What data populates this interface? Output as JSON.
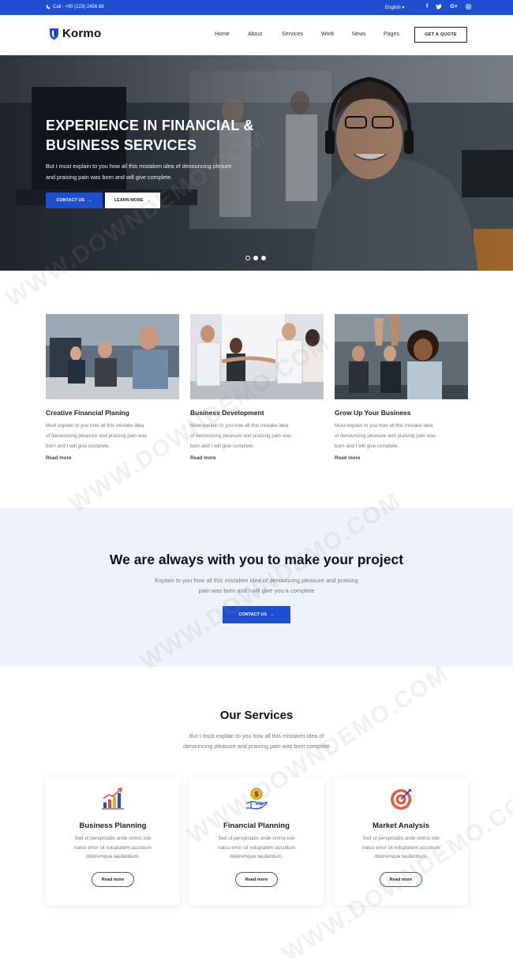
{
  "topbar": {
    "phone": "Call : +00 (123) 2456 88",
    "language": "English",
    "socials": [
      "f",
      "t",
      "G+",
      "ig"
    ]
  },
  "header": {
    "brand": "Kormo",
    "nav": [
      "Home",
      "About",
      "Services",
      "Work",
      "News",
      "Pages"
    ],
    "quote_button": "GET A QUOTE"
  },
  "hero": {
    "title_line1": "EXPERIENCE IN FINANCIAL &",
    "title_line2": "BUSINESS SERVICES",
    "text_line1": "But I must explain to you how all this mistaken idea of denouncing plesure",
    "text_line2": "and praising pain was born and will give complete.",
    "contact_button": "CONTACT US",
    "learn_button": "LEARN MORE",
    "slides": 3,
    "active_slide": 2
  },
  "cards": [
    {
      "title": "Creative Financial Planing",
      "line1": "Must explain to you how all this mistake idea",
      "line2": "of denouncing pleasure and praising pain was",
      "line3": "born and I will give complete.",
      "more": "Read more"
    },
    {
      "title": "Business Development",
      "line1": "Must explain to you how all this mistake idea",
      "line2": "of denouncing pleasure and praising pain was",
      "line3": "born and I will give complete.",
      "more": "Read more"
    },
    {
      "title": "Grow Up Your Business",
      "line1": "Must explain to you how all this mistake idea",
      "line2": "of denouncing pleasure and praising pain was",
      "line3": "born and I will give complete.",
      "more": "Read more"
    }
  ],
  "cta": {
    "title": "We are always with you to make your project",
    "text_line1": "Explain to you how all this mistaken idea of denouncing pleasure and praising",
    "text_line2": "pain was born and I will give you a complete",
    "button": "CONTACT US"
  },
  "services": {
    "title": "Our Services",
    "sub_line1": "But I must explain to you how all this mistaken idea of",
    "sub_line2": "denouncing pleasure and praising pain was born complete",
    "items": [
      {
        "icon": "growth-chart-icon",
        "title": "Business Planning",
        "line1": "Sed ut perspiciatis unde omnis iste",
        "line2": "natus error sit voluptatem accutium",
        "line3": "doloremque laudantium.",
        "button": "Read more"
      },
      {
        "icon": "dollar-hand-icon",
        "title": "Financial Planning",
        "line1": "Sed ut perspiciatis unde omnis iste",
        "line2": "natus error sit voluptatem accutium",
        "line3": "doloremque laudantium.",
        "button": "Read more"
      },
      {
        "icon": "target-icon",
        "title": "Market Analysis",
        "line1": "Sed ut perspiciatis unde omnis iste",
        "line2": "natus error sit voluptatem accutium",
        "line3": "doloremque laudantium.",
        "button": "Read more"
      }
    ]
  },
  "watermark": "WWW.DOWNDEMO.COM",
  "colors": {
    "primary": "#1f4fd1",
    "cta_bg": "#eef3fb",
    "text": "#222222",
    "muted": "#777777"
  }
}
